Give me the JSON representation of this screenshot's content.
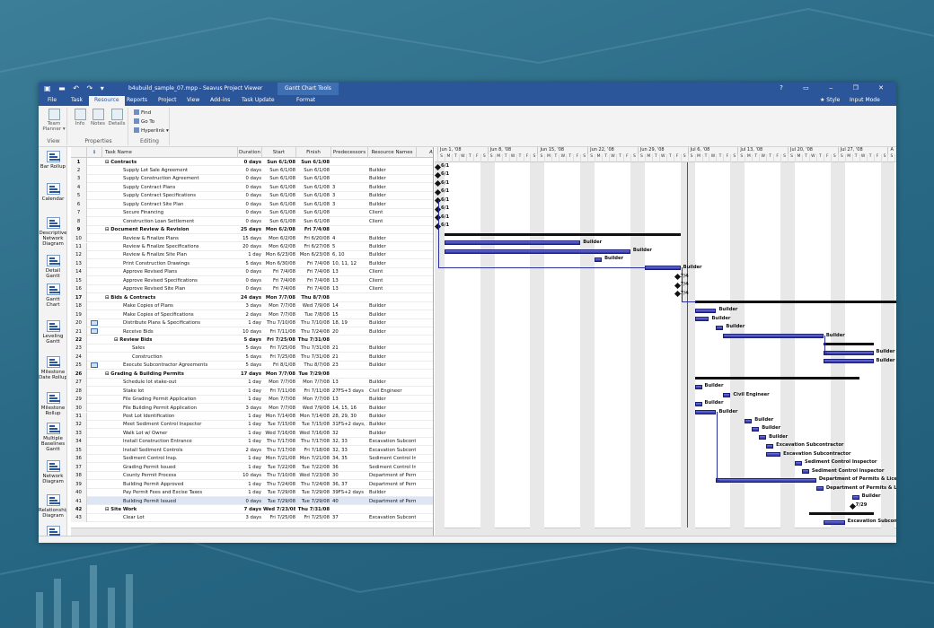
{
  "window": {
    "title": "b4ubuild_sample_07.mpp - Seavus Project Viewer",
    "context_title": "Gantt Chart Tools"
  },
  "tabs": [
    "File",
    "Task",
    "Resource",
    "Reports",
    "Project",
    "View",
    "Add-ins",
    "Task Update",
    "Format"
  ],
  "active_tab": "Resource",
  "tabs_right": {
    "style": "★ Style",
    "mode": "Input Mode"
  },
  "ribbon": {
    "view_group": {
      "button": "Team Planner ▾",
      "label": "View"
    },
    "properties_group": {
      "buttons": [
        "Info",
        "Notes",
        "Details"
      ],
      "label": "Properties"
    },
    "editing_group": {
      "buttons": [
        "Find",
        "Go To",
        "Hyperlink ▾"
      ],
      "label": "Editing"
    }
  },
  "views": [
    "Bar Rollup",
    "Calendar",
    "Descriptive Network Diagram",
    "Detail Gantt",
    "Gantt Chart",
    "Leveling Gantt",
    "Milestone Date Rollup",
    "Milestone Rollup",
    "Multiple Baselines Gantt",
    "Network Diagram",
    "Relationship Diagram",
    "Task Form"
  ],
  "columns": {
    "info": "ℹ",
    "task_name": "Task Name",
    "duration": "Duration",
    "start": "Start",
    "finish": "Finish",
    "predecessors": "Predecessors",
    "resources": "Resource Names",
    "add": "Add New Colum"
  },
  "rows": [
    {
      "id": "1",
      "name": "⊟ Contracts",
      "dur": "0 days",
      "start": "Sun 6/1/08",
      "finish": "Sun 6/1/08",
      "pred": "",
      "res": "",
      "lvl": 0,
      "sum": true
    },
    {
      "id": "2",
      "name": "Supply Lot Sale Agreement",
      "dur": "0 days",
      "start": "Sun 6/1/08",
      "finish": "Sun 6/1/08",
      "pred": "",
      "res": "Builder",
      "lvl": 2
    },
    {
      "id": "3",
      "name": "Supply Construction Agreement",
      "dur": "0 days",
      "start": "Sun 6/1/08",
      "finish": "Sun 6/1/08",
      "pred": "",
      "res": "Builder",
      "lvl": 2
    },
    {
      "id": "4",
      "name": "Supply Contract Plans",
      "dur": "0 days",
      "start": "Sun 6/1/08",
      "finish": "Sun 6/1/08",
      "pred": "3",
      "res": "Builder",
      "lvl": 2
    },
    {
      "id": "5",
      "name": "Supply Contract Specifications",
      "dur": "0 days",
      "start": "Sun 6/1/08",
      "finish": "Sun 6/1/08",
      "pred": "3",
      "res": "Builder",
      "lvl": 2
    },
    {
      "id": "6",
      "name": "Supply Contract Site Plan",
      "dur": "0 days",
      "start": "Sun 6/1/08",
      "finish": "Sun 6/1/08",
      "pred": "3",
      "res": "Builder",
      "lvl": 2
    },
    {
      "id": "7",
      "name": "Secure Financing",
      "dur": "0 days",
      "start": "Sun 6/1/08",
      "finish": "Sun 6/1/08",
      "pred": "",
      "res": "Client",
      "lvl": 2
    },
    {
      "id": "8",
      "name": "Construction Loan Settlement",
      "dur": "0 days",
      "start": "Sun 6/1/08",
      "finish": "Sun 6/1/08",
      "pred": "",
      "res": "Client",
      "lvl": 2
    },
    {
      "id": "9",
      "name": "⊟ Document Review & Revision",
      "dur": "25 days",
      "start": "Mon 6/2/08",
      "finish": "Fri 7/4/08",
      "pred": "",
      "res": "",
      "lvl": 0,
      "sum": true
    },
    {
      "id": "10",
      "name": "Review & Finalize Plans",
      "dur": "15 days",
      "start": "Mon 6/2/08",
      "finish": "Fri 6/20/08",
      "pred": "4",
      "res": "Builder",
      "lvl": 2
    },
    {
      "id": "11",
      "name": "Review & Finalize Specifications",
      "dur": "20 days",
      "start": "Mon 6/2/08",
      "finish": "Fri 6/27/08",
      "pred": "5",
      "res": "Builder",
      "lvl": 2
    },
    {
      "id": "12",
      "name": "Review & Finalize Site Plan",
      "dur": "1 day",
      "start": "Mon 6/23/08",
      "finish": "Mon 6/23/08",
      "pred": "6, 10",
      "res": "Builder",
      "lvl": 2
    },
    {
      "id": "13",
      "name": "Print Construction Drawings",
      "dur": "5 days",
      "start": "Mon 6/30/08",
      "finish": "Fri 7/4/08",
      "pred": "10, 11, 12",
      "res": "Builder",
      "lvl": 2
    },
    {
      "id": "14",
      "name": "Approve Revised Plans",
      "dur": "0 days",
      "start": "Fri 7/4/08",
      "finish": "Fri 7/4/08",
      "pred": "13",
      "res": "Client",
      "lvl": 2
    },
    {
      "id": "15",
      "name": "Approve Revised Specifications",
      "dur": "0 days",
      "start": "Fri 7/4/08",
      "finish": "Fri 7/4/08",
      "pred": "13",
      "res": "Client",
      "lvl": 2
    },
    {
      "id": "16",
      "name": "Approve Revised Site Plan",
      "dur": "0 days",
      "start": "Fri 7/4/08",
      "finish": "Fri 7/4/08",
      "pred": "13",
      "res": "Client",
      "lvl": 2
    },
    {
      "id": "17",
      "name": "⊟ Bids & Contracts",
      "dur": "24 days",
      "start": "Mon 7/7/08",
      "finish": "Thu 8/7/08",
      "pred": "",
      "res": "",
      "lvl": 0,
      "sum": true
    },
    {
      "id": "18",
      "name": "Make Copies of Plans",
      "dur": "3 days",
      "start": "Mon 7/7/08",
      "finish": "Wed 7/9/08",
      "pred": "14",
      "res": "Builder",
      "lvl": 2
    },
    {
      "id": "19",
      "name": "Make Copies of Specifications",
      "dur": "2 days",
      "start": "Mon 7/7/08",
      "finish": "Tue 7/8/08",
      "pred": "15",
      "res": "Builder",
      "lvl": 2
    },
    {
      "id": "20",
      "name": "Distribute Plans & Specifications",
      "dur": "1 day",
      "start": "Thu 7/10/08",
      "finish": "Thu 7/10/08",
      "pred": "18, 19",
      "res": "Builder",
      "lvl": 2,
      "icon": true
    },
    {
      "id": "21",
      "name": "Receive Bids",
      "dur": "10 days",
      "start": "Fri 7/11/08",
      "finish": "Thu 7/24/08",
      "pred": "20",
      "res": "Builder",
      "lvl": 2,
      "icon": true
    },
    {
      "id": "22",
      "name": "⊟ Review Bids",
      "dur": "5 days",
      "start": "Fri 7/25/08",
      "finish": "Thu 7/31/08",
      "pred": "",
      "res": "",
      "lvl": 1,
      "sum": true
    },
    {
      "id": "23",
      "name": "Sales",
      "dur": "5 days",
      "start": "Fri 7/25/08",
      "finish": "Thu 7/31/08",
      "pred": "21",
      "res": "Builder",
      "lvl": 3
    },
    {
      "id": "24",
      "name": "Construction",
      "dur": "5 days",
      "start": "Fri 7/25/08",
      "finish": "Thu 7/31/08",
      "pred": "21",
      "res": "Builder",
      "lvl": 3
    },
    {
      "id": "25",
      "name": "Execute Subcontractor Agreements",
      "dur": "5 days",
      "start": "Fri 8/1/08",
      "finish": "Thu 8/7/08",
      "pred": "23",
      "res": "Builder",
      "lvl": 2,
      "icon": true
    },
    {
      "id": "26",
      "name": "⊟ Grading & Building Permits",
      "dur": "17 days",
      "start": "Mon 7/7/08",
      "finish": "Tue 7/29/08",
      "pred": "",
      "res": "",
      "lvl": 0,
      "sum": true
    },
    {
      "id": "27",
      "name": "Schedule lot stake-out",
      "dur": "1 day",
      "start": "Mon 7/7/08",
      "finish": "Mon 7/7/08",
      "pred": "13",
      "res": "Builder",
      "lvl": 2
    },
    {
      "id": "28",
      "name": "Stake lot",
      "dur": "1 day",
      "start": "Fri 7/11/08",
      "finish": "Fri 7/11/08",
      "pred": "27FS+3 days",
      "res": "Civil Engineer",
      "lvl": 2
    },
    {
      "id": "29",
      "name": "File Grading Permit Application",
      "dur": "1 day",
      "start": "Mon 7/7/08",
      "finish": "Mon 7/7/08",
      "pred": "13",
      "res": "Builder",
      "lvl": 2
    },
    {
      "id": "30",
      "name": "File Building Permit Application",
      "dur": "3 days",
      "start": "Mon 7/7/08",
      "finish": "Wed 7/9/08",
      "pred": "14, 15, 16",
      "res": "Builder",
      "lvl": 2
    },
    {
      "id": "31",
      "name": "Post Lot Identification",
      "dur": "1 day",
      "start": "Mon 7/14/08",
      "finish": "Mon 7/14/08",
      "pred": "28, 29, 30",
      "res": "Builder",
      "lvl": 2
    },
    {
      "id": "32",
      "name": "Meet Sediment Control Inspector",
      "dur": "1 day",
      "start": "Tue 7/15/08",
      "finish": "Tue 7/15/08",
      "pred": "31FS+2 days, 28",
      "res": "Builder",
      "lvl": 2
    },
    {
      "id": "33",
      "name": "Walk Lot w/ Owner",
      "dur": "1 day",
      "start": "Wed 7/16/08",
      "finish": "Wed 7/16/08",
      "pred": "32",
      "res": "Builder",
      "lvl": 2
    },
    {
      "id": "34",
      "name": "Install Construction Entrance",
      "dur": "1 day",
      "start": "Thu 7/17/08",
      "finish": "Thu 7/17/08",
      "pred": "32, 33",
      "res": "Excavation Subcontra",
      "lvl": 2
    },
    {
      "id": "35",
      "name": "Install Sediment Controls",
      "dur": "2 days",
      "start": "Thu 7/17/08",
      "finish": "Fri 7/18/08",
      "pred": "32, 33",
      "res": "Excavation Subcontra",
      "lvl": 2
    },
    {
      "id": "36",
      "name": "Sediment Control Insp.",
      "dur": "1 day",
      "start": "Mon 7/21/08",
      "finish": "Mon 7/21/08",
      "pred": "34, 35",
      "res": "Sediment Control Insp",
      "lvl": 2
    },
    {
      "id": "37",
      "name": "Grading Permit Issued",
      "dur": "1 day",
      "start": "Tue 7/22/08",
      "finish": "Tue 7/22/08",
      "pred": "36",
      "res": "Sediment Control Insp",
      "lvl": 2
    },
    {
      "id": "38",
      "name": "County Permit Process",
      "dur": "10 days",
      "start": "Thu 7/10/08",
      "finish": "Wed 7/23/08",
      "pred": "30",
      "res": "Department of Permits",
      "lvl": 2
    },
    {
      "id": "39",
      "name": "Building Permit Approved",
      "dur": "1 day",
      "start": "Thu 7/24/08",
      "finish": "Thu 7/24/08",
      "pred": "36, 37",
      "res": "Department of Permits",
      "lvl": 2
    },
    {
      "id": "40",
      "name": "Pay Permit Fees and Excise Taxes",
      "dur": "1 day",
      "start": "Tue 7/29/08",
      "finish": "Tue 7/29/08",
      "pred": "39FS+2 days",
      "res": "Builder",
      "lvl": 2
    },
    {
      "id": "41",
      "name": "Building Permit Issued",
      "dur": "0 days",
      "start": "Tue 7/29/08",
      "finish": "Tue 7/29/08",
      "pred": "40",
      "res": "Department of Permits",
      "lvl": 2,
      "sel": true
    },
    {
      "id": "42",
      "name": "⊟ Site Work",
      "dur": "7 days",
      "start": "Wed 7/23/08",
      "finish": "Thu 7/31/08",
      "pred": "",
      "res": "",
      "lvl": 0,
      "sum": true
    },
    {
      "id": "43",
      "name": "Clear Lot",
      "dur": "3 days",
      "start": "Fri 7/25/08",
      "finish": "Fri 7/25/08",
      "pred": "37",
      "res": "Excavation Subcontra",
      "lvl": 2
    }
  ],
  "timeline": {
    "weeks": [
      "Jun 1, '08",
      "Jun 8, '08",
      "Jun 15, '08",
      "Jun 22, '08",
      "Jun 29, '08",
      "Jul 6, '08",
      "Jul 13, '08",
      "Jul 20, '08",
      "Jul 27, '08",
      "A"
    ],
    "days": [
      "S",
      "M",
      "T",
      "W",
      "T",
      "F",
      "S"
    ]
  },
  "gantt_labels": {
    "ms": "6/1",
    "ms14": "7/4",
    "ms41": "7/29",
    "builder": "Builder",
    "civil": "Civil Engineer",
    "exc": "Excavation Subcontractor",
    "sci": "Sediment Control Inspector",
    "dop": "Department of Permits & Lice",
    "dop2": "Department of Permits & L",
    "excb": "Excavation Subcontrac"
  },
  "colors": {
    "title": "#2b579a",
    "bar": "#2a2f9e"
  }
}
